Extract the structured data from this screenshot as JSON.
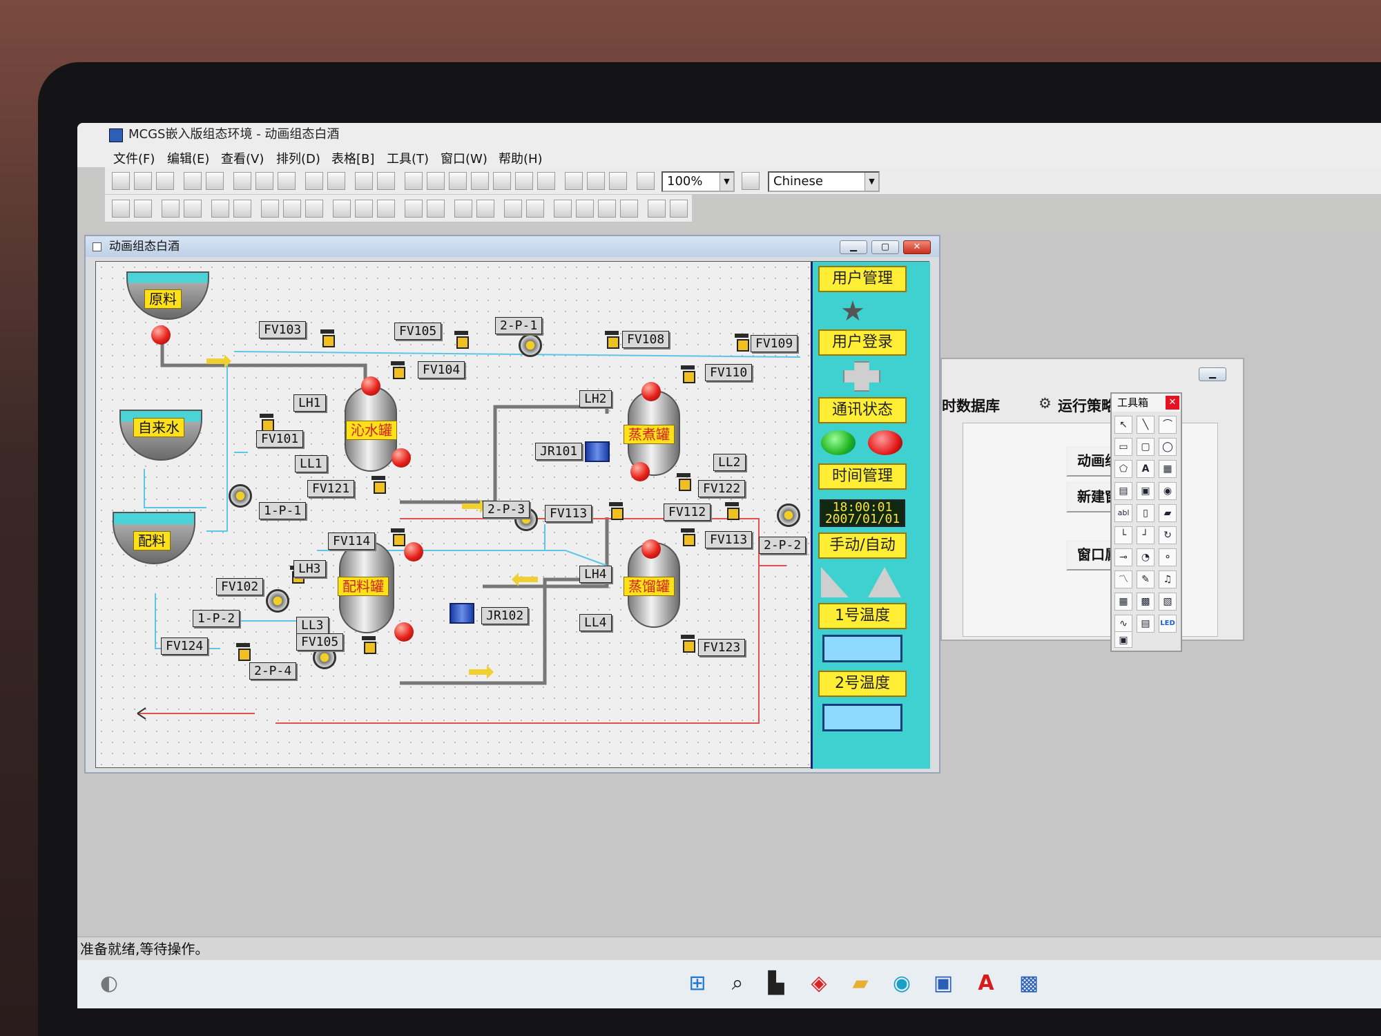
{
  "app": {
    "title": "MCGS嵌入版组态环境 - 动画组态白酒"
  },
  "menu": [
    "文件(F)",
    "编辑(E)",
    "查看(V)",
    "排列(D)",
    "表格[B]",
    "工具(T)",
    "窗口(W)",
    "帮助(H)"
  ],
  "toolbar": {
    "zoom": "100%",
    "language": "Chinese"
  },
  "window": {
    "title": "动画组态白酒"
  },
  "schematic": {
    "tanks": {
      "raw": "原料",
      "water": "自来水",
      "mix": "配料"
    },
    "vessels": {
      "soak": "沁水罐",
      "cook": "蒸煮罐",
      "blend": "配料罐",
      "distill": "蒸馏罐"
    },
    "tags": {
      "FV103": "FV103",
      "FV105a": "FV105",
      "P2_1": "2-P-1",
      "FV108": "FV108",
      "FV109": "FV109",
      "FV104": "FV104",
      "FV110": "FV110",
      "LH1": "LH1",
      "LH2": "LH2",
      "FV101": "FV101",
      "JR101": "JR101",
      "LL1": "LL1",
      "LL2": "LL2",
      "FV121": "FV121",
      "FV122": "FV122",
      "P1_1": "1-P-1",
      "P2_3": "2-P-3",
      "FV113a": "FV113",
      "FV112": "FV112",
      "FV114": "FV114",
      "FV113b": "FV113",
      "P2_2": "2-P-2",
      "LH3": "LH3",
      "LH4": "LH4",
      "FV102": "FV102",
      "P1_2": "1-P-2",
      "JR102": "JR102",
      "LL3": "LL3",
      "LL4": "LL4",
      "FV124": "FV124",
      "FV105b": "FV105",
      "FV123": "FV123",
      "P2_4": "2-P-4"
    }
  },
  "panel": {
    "user_mgmt": "用户管理",
    "user_login": "用户登录",
    "comm_status": "通讯状态",
    "time_mgmt": "时间管理",
    "clock_time": "18:00:01",
    "clock_date": "2007/01/01",
    "manual_auto": "手动/自动",
    "temp1": "1号温度",
    "temp2": "2号温度"
  },
  "workspace": {
    "tab_db": "时数据库",
    "tab_strategy": "运行策略",
    "btn_anim": "动画组态",
    "btn_new": "新建窗口",
    "btn_prop": "窗口属性"
  },
  "toolbox": {
    "title": "工具箱",
    "text_tool": "A",
    "label_tool": "abl",
    "led_tool": "LED"
  },
  "status": {
    "text": "准备就绪,等待操作。"
  }
}
